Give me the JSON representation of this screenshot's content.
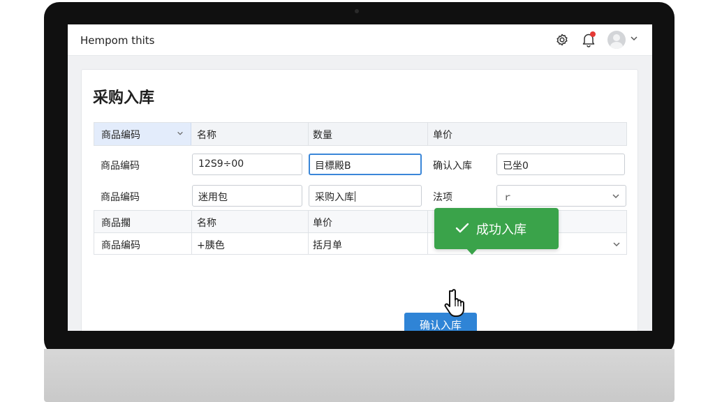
{
  "app": {
    "title": "Hempom thits"
  },
  "page": {
    "title": "采购入库"
  },
  "header": {
    "col1": "商品编码",
    "col2": "名称",
    "col3": "数量",
    "col4": "单价"
  },
  "row1": {
    "label": "商品编码",
    "code_value": "12S9÷00",
    "qty_value": "目標殿Β",
    "confirm_label": "确认入库",
    "confirm_value": "已坐0"
  },
  "row2": {
    "label": "商品编码",
    "name_value": "迷用包",
    "input_value": "采购入库",
    "other_label": "法项",
    "select_value": "ｒ"
  },
  "subgrid": {
    "r1c1": "商品擱",
    "r1c2": "名称",
    "r1c3": "单价",
    "r2c1": "商品编码",
    "r2c2": "+胰色",
    "r2c3": "括月单"
  },
  "actions": {
    "confirm_button": "确认入库"
  },
  "toast": {
    "message": "成功入库"
  },
  "colors": {
    "primary": "#2f84d6",
    "success": "#3aa34a",
    "badge": "#e53935"
  }
}
